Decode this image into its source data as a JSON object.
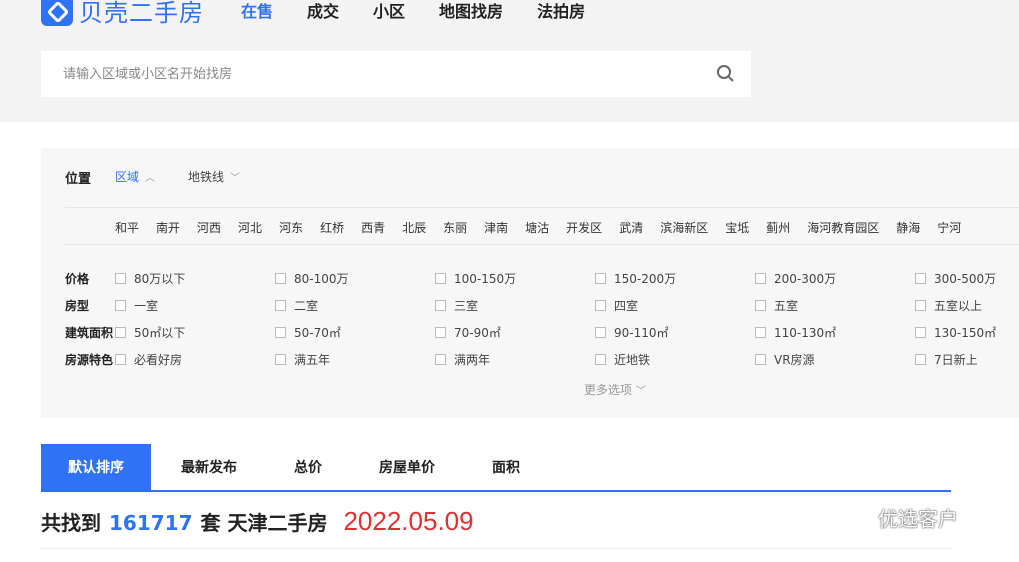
{
  "brand": {
    "name": "贝壳二手房",
    "color": "#3072f6"
  },
  "nav": [
    "在售",
    "成交",
    "小区",
    "地图找房",
    "法拍房"
  ],
  "search": {
    "placeholder": "请输入区域或小区名开始找房",
    "value": ""
  },
  "location": {
    "label": "位置",
    "tabs": [
      {
        "label": "区域",
        "icon": "chevron-up-icon",
        "active": true
      },
      {
        "label": "地铁线",
        "icon": "chevron-down-icon",
        "active": false
      }
    ],
    "districts": [
      "和平",
      "南开",
      "河西",
      "河北",
      "河东",
      "红桥",
      "西青",
      "北辰",
      "东丽",
      "津南",
      "塘沽",
      "开发区",
      "武清",
      "滨海新区",
      "宝坻",
      "蓟州",
      "海河教育园区",
      "静海",
      "宁河"
    ]
  },
  "filters": [
    {
      "label": "价格",
      "options": [
        "80万以下",
        "80-100万",
        "100-150万",
        "150-200万",
        "200-300万",
        "300-500万"
      ]
    },
    {
      "label": "房型",
      "options": [
        "一室",
        "二室",
        "三室",
        "四室",
        "五室",
        "五室以上"
      ]
    },
    {
      "label": "建筑面积",
      "options": [
        "50㎡以下",
        "50-70㎡",
        "70-90㎡",
        "90-110㎡",
        "110-130㎡",
        "130-150㎡"
      ]
    },
    {
      "label": "房源特色",
      "options": [
        "必看好房",
        "满五年",
        "满两年",
        "近地铁",
        "VR房源",
        "7日新上"
      ]
    }
  ],
  "more_options": "更多选项",
  "sort_tabs": [
    "默认排序",
    "最新发布",
    "总价",
    "房屋单价",
    "面积"
  ],
  "result": {
    "prefix": "共找到",
    "count": "161717",
    "suffix": "套 天津二手房",
    "date": "2022.05.09"
  },
  "watermark": "优选客户"
}
